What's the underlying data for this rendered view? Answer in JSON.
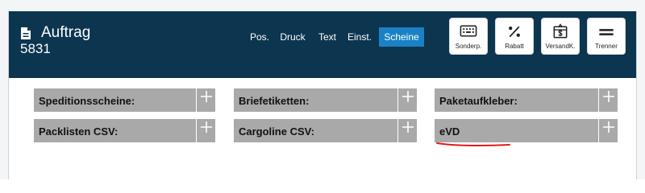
{
  "header": {
    "title": "Auftrag",
    "order_number": "5831"
  },
  "tabs": [
    {
      "label": "Pos.",
      "active": false
    },
    {
      "label": "Druck",
      "active": false
    },
    {
      "label": "Text",
      "active": false
    },
    {
      "label": "Einst.",
      "active": false
    },
    {
      "label": "Scheine",
      "active": true
    }
  ],
  "toolbar": [
    {
      "label": "Sonderp.",
      "icon": "keyboard-icon"
    },
    {
      "label": "Rabatt",
      "icon": "percent-icon"
    },
    {
      "label": "VersandK.",
      "icon": "shipping-box-icon"
    },
    {
      "label": "Trenner",
      "icon": "separator-icon"
    }
  ],
  "cards": [
    {
      "label": "Speditionsscheine:",
      "action_icon": "plus-icon"
    },
    {
      "label": "Briefetiketten:",
      "action_icon": "plus-icon"
    },
    {
      "label": "Paketaufkleber:",
      "action_icon": "plus-icon"
    },
    {
      "label": "Packlisten CSV:",
      "action_icon": "plus-icon"
    },
    {
      "label": "Cargoline CSV:",
      "action_icon": "plus-icon"
    },
    {
      "label": "eVD",
      "action_icon": "plus-icon"
    }
  ],
  "colors": {
    "header_bg": "#0c3550",
    "active_tab": "#1a82c4",
    "card_bg": "#a9a9a9",
    "annotation_underline": "#e01b1b"
  }
}
